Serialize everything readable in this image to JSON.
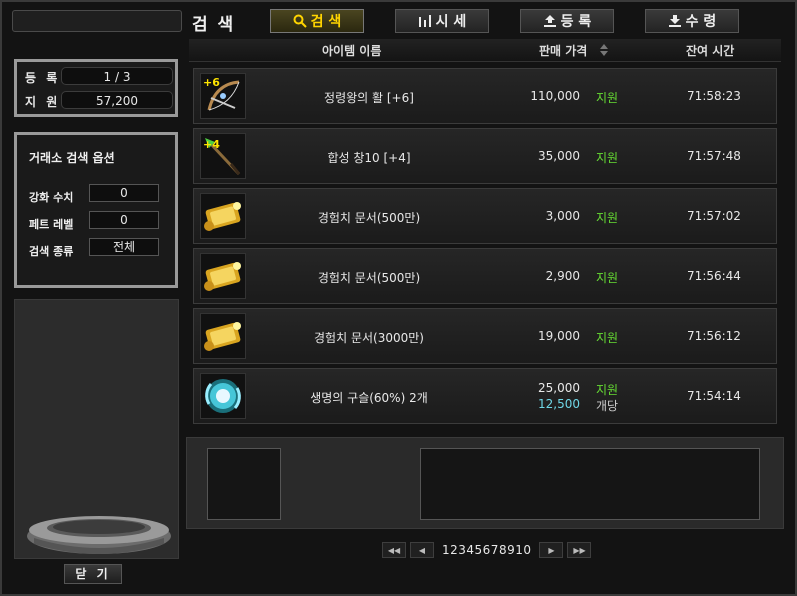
{
  "title": "검 색",
  "tabs": [
    {
      "label": "검 색",
      "icon": "search-icon"
    },
    {
      "label": "시 세",
      "icon": "bar-chart-icon"
    },
    {
      "label": "등 록",
      "icon": "upload-icon"
    },
    {
      "label": "수 령",
      "icon": "download-icon"
    }
  ],
  "info": {
    "registered_label": "등 록",
    "registered_value": "1 / 3",
    "balance_label": "지 원",
    "balance_value": "57,200"
  },
  "options": {
    "heading": "거래소 검색 옵션",
    "enhance_label": "강화 수치",
    "enhance_value": "0",
    "pet_label": "페트 레벨",
    "pet_value": "0",
    "type_label": "검색 종류",
    "type_value": "전체"
  },
  "table": {
    "col_name": "아이템 이름",
    "col_price": "판매 가격",
    "col_time": "잔여 시간",
    "rows": [
      {
        "name": "정령왕의 활 [+6]",
        "price": "110,000",
        "unit": "지원",
        "time": "71:58:23",
        "icon": "bow-icon",
        "badge": "+6"
      },
      {
        "name": "합성 창10 [+4]",
        "price": "35,000",
        "unit": "지원",
        "time": "71:57:48",
        "icon": "spear-icon",
        "badge": "+4"
      },
      {
        "name": "경험치 문서(500만)",
        "price": "3,000",
        "unit": "지원",
        "time": "71:57:02",
        "icon": "scroll-icon"
      },
      {
        "name": "경험치 문서(500만)",
        "price": "2,900",
        "unit": "지원",
        "time": "71:56:44",
        "icon": "scroll-icon"
      },
      {
        "name": "경험치 문서(3000만)",
        "price": "19,000",
        "unit": "지원",
        "time": "71:56:12",
        "icon": "scroll-icon"
      },
      {
        "name": "생명의 구슬(60%) 2개",
        "price": "25,000",
        "unit": "지원",
        "price_each": "12,500",
        "unit_each": "개당",
        "time": "71:54:14",
        "icon": "orb-icon"
      }
    ]
  },
  "pager": {
    "pages": "12345678910"
  },
  "close_label": "닫 기"
}
